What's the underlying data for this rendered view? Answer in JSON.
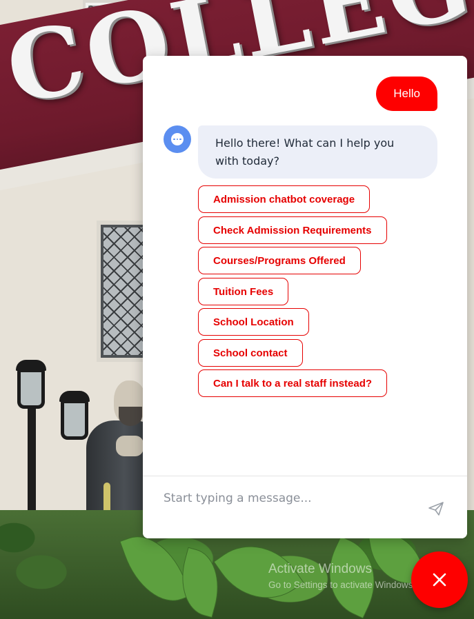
{
  "background": {
    "sign_letters": "COLLEGE"
  },
  "chat": {
    "user_message": "Hello",
    "bot_avatar_icon": "chatbot-face-icon",
    "bot_message": "Hello there! What can I help you with today?",
    "quick_replies": [
      "Admission chatbot coverage",
      "Check Admission Requirements",
      "Courses/Programs Offered",
      "Tuition Fees",
      "School Location",
      "School contact",
      "Can I talk to a real staff instead?"
    ],
    "input_placeholder": "Start typing a message...",
    "send_icon": "paper-plane-icon"
  },
  "fab": {
    "icon": "close-icon"
  },
  "watermark": {
    "title": "Activate Windows",
    "subtitle": "Go to Settings to activate Windows."
  },
  "colors": {
    "accent_red": "#fe0000",
    "bot_bubble": "#eceff8",
    "avatar_blue": "#5b8ef0"
  }
}
